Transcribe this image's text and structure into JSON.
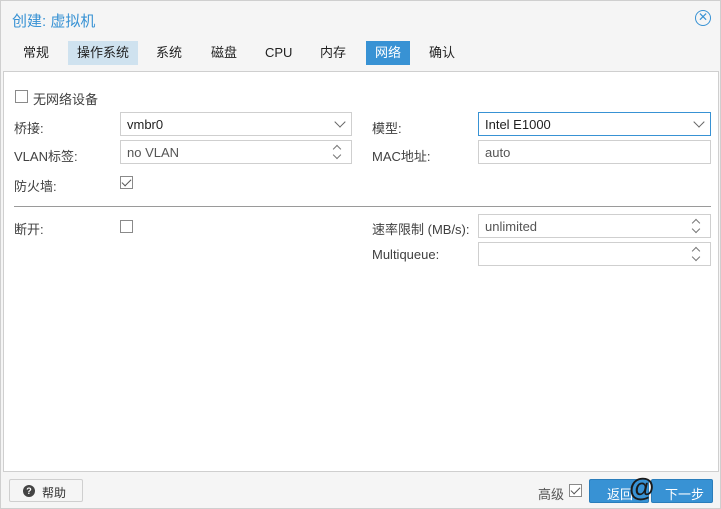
{
  "window": {
    "title": "创建: 虚拟机"
  },
  "tabs": [
    {
      "label": "常规"
    },
    {
      "label": "操作系统"
    },
    {
      "label": "系统"
    },
    {
      "label": "磁盘"
    },
    {
      "label": "CPU"
    },
    {
      "label": "内存"
    },
    {
      "label": "网络"
    },
    {
      "label": "确认"
    }
  ],
  "form": {
    "no_network": {
      "label": "无网络设备",
      "checked": false
    },
    "bridge": {
      "label": "桥接:",
      "value": "vmbr0"
    },
    "model": {
      "label": "模型:",
      "value": "Intel E1000"
    },
    "vlan": {
      "label": "VLAN标签:",
      "value": "no VLAN"
    },
    "mac": {
      "label": "MAC地址:",
      "value": "auto"
    },
    "firewall": {
      "label": "防火墙:",
      "checked": true
    },
    "disconnect": {
      "label": "断开:",
      "checked": false
    },
    "rate_limit": {
      "label": "速率限制 (MB/s):",
      "value": "unlimited"
    },
    "multiqueue": {
      "label": "Multiqueue:",
      "value": ""
    }
  },
  "footer": {
    "help_label": "帮助",
    "advanced_label": "高级",
    "advanced_checked": true,
    "back_label": "返回",
    "next_label": "下一步",
    "watermark": "@"
  },
  "colors": {
    "accent": "#3892d4",
    "tab_selected": "#cfe2ef"
  }
}
